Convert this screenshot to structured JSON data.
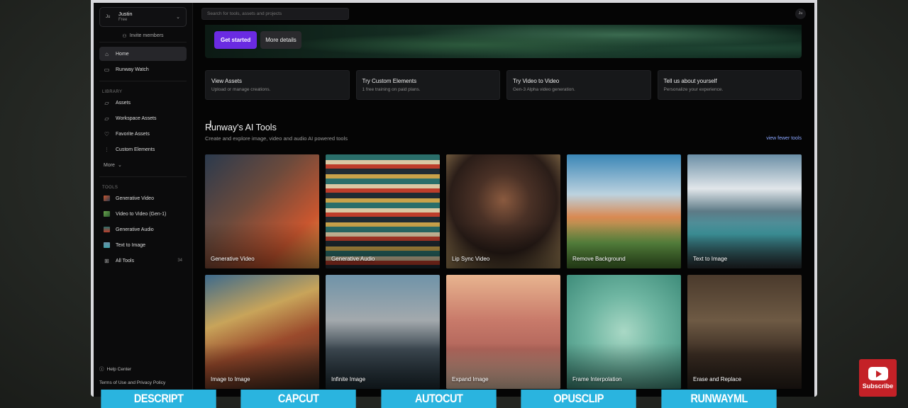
{
  "workspace": {
    "avatar": "Ju",
    "name": "Justin",
    "plan": "Free"
  },
  "sidebar": {
    "invite_label": "Invite members",
    "nav": [
      {
        "label": "Home",
        "icon": "home-icon"
      },
      {
        "label": "Runway Watch",
        "icon": "tv-icon"
      }
    ],
    "library_label": "LIBRARY",
    "library": [
      {
        "label": "Assets",
        "icon": "folder-icon"
      },
      {
        "label": "Workspace Assets",
        "icon": "workspace-folder-icon"
      },
      {
        "label": "Favorite Assets",
        "icon": "heart-icon"
      },
      {
        "label": "Custom Elements",
        "icon": "sliders-icon"
      }
    ],
    "more_label": "More",
    "tools_label": "TOOLS",
    "tools": [
      {
        "label": "Generative Video"
      },
      {
        "label": "Video to Video (Gen-1)"
      },
      {
        "label": "Generative Audio"
      },
      {
        "label": "Text to Image"
      },
      {
        "label": "All Tools",
        "count": "34"
      }
    ],
    "help_label": "Help Center",
    "terms_label": "Terms of Use and Privacy Policy"
  },
  "topbar": {
    "search_placeholder": "Search for tools, assets and projects",
    "user_initials": "Ju"
  },
  "hero": {
    "primary_label": "Get started",
    "secondary_label": "More details"
  },
  "quick_cards": [
    {
      "title": "View Assets",
      "subtitle": "Upload or manage creations."
    },
    {
      "title": "Try Custom Elements",
      "subtitle": "1 free training on paid plans."
    },
    {
      "title": "Try Video to Video",
      "subtitle": "Gen-3 Alpha video generation."
    },
    {
      "title": "Tell us about yourself",
      "subtitle": "Personalize your experience."
    }
  ],
  "tools_section": {
    "title": "Runway's AI Tools",
    "subtitle": "Create and explore image, video and audio AI powered tools",
    "view_fewer": "view fewer tools"
  },
  "tool_tiles": [
    "Generative Video",
    "Generative Audio",
    "Lip Sync Video",
    "Remove Background",
    "Text to Image",
    "Image to Image",
    "Infinite Image",
    "Expand Image",
    "Frame Interpolation",
    "Erase and Replace"
  ],
  "banner": [
    "DESCRIPT",
    "CAPCUT",
    "AUTOCUT",
    "OPUSCLIP",
    "RUNWAYML"
  ],
  "subscribe_label": "Subscribe",
  "colors": {
    "accent": "#6a2be2",
    "banner": "#2ab4df",
    "subscribe": "#c42127"
  }
}
